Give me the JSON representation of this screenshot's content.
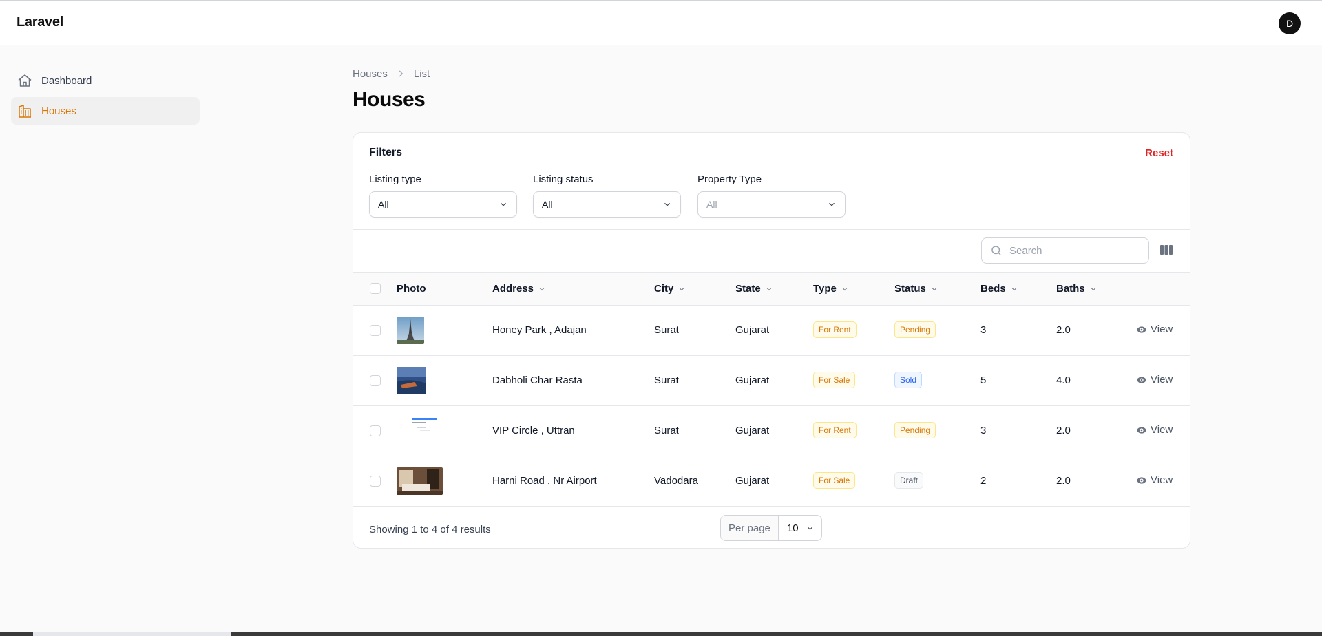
{
  "app": {
    "brand": "Laravel",
    "user_initial": "D"
  },
  "sidebar": {
    "items": [
      {
        "label": "Dashboard",
        "icon": "home-icon",
        "active": false
      },
      {
        "label": "Houses",
        "icon": "building-icon",
        "active": true
      }
    ]
  },
  "breadcrumb": {
    "parent": "Houses",
    "current": "List"
  },
  "page": {
    "title": "Houses"
  },
  "filters": {
    "heading": "Filters",
    "reset_label": "Reset",
    "listing_type": {
      "label": "Listing type",
      "value": "All"
    },
    "listing_status": {
      "label": "Listing status",
      "value": "All"
    },
    "property_type": {
      "label": "Property Type",
      "placeholder": "All"
    }
  },
  "search": {
    "placeholder": "Search"
  },
  "table": {
    "columns": [
      "Photo",
      "Address",
      "City",
      "State",
      "Type",
      "Status",
      "Beds",
      "Baths"
    ],
    "rows": [
      {
        "address": "Honey Park , Adajan",
        "city": "Surat",
        "state": "Gujarat",
        "type": "For Rent",
        "status": "Pending",
        "beds": "3",
        "baths": "2.0",
        "action": "View"
      },
      {
        "address": "Dabholi Char Rasta",
        "city": "Surat",
        "state": "Gujarat",
        "type": "For Sale",
        "status": "Sold",
        "beds": "5",
        "baths": "4.0",
        "action": "View"
      },
      {
        "address": "VIP Circle , Uttran",
        "city": "Surat",
        "state": "Gujarat",
        "type": "For Rent",
        "status": "Pending",
        "beds": "3",
        "baths": "2.0",
        "action": "View"
      },
      {
        "address": "Harni Road , Nr Airport",
        "city": "Vadodara",
        "state": "Gujarat",
        "type": "For Sale",
        "status": "Draft",
        "beds": "2",
        "baths": "2.0",
        "action": "View"
      }
    ]
  },
  "pagination": {
    "summary": "Showing 1 to 4 of 4 results",
    "per_page_label": "Per page",
    "per_page_value": "10"
  },
  "colors": {
    "accent": "#d97706",
    "danger": "#dc2626",
    "info": "#2563eb"
  }
}
